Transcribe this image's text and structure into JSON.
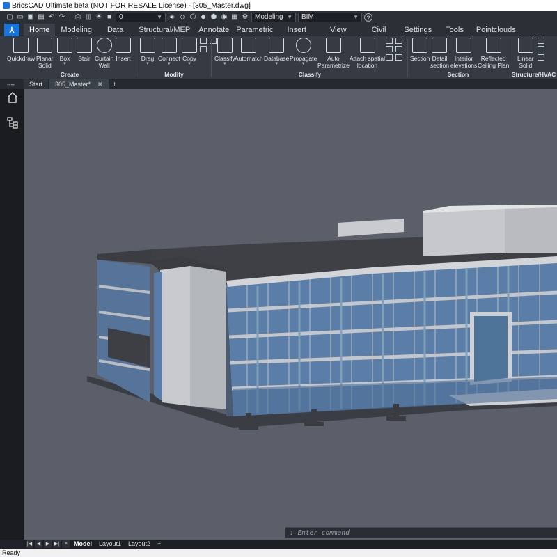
{
  "window": {
    "title": "BricsCAD Ultimate beta (NOT FOR RESALE License) - [305_Master.dwg]"
  },
  "quick_access": {
    "layer_value": "0",
    "workspace_value": "Modeling",
    "profile_value": "BIM",
    "help_label": "?"
  },
  "ribbon_tabs": [
    "Home",
    "Modeling",
    "Data",
    "Structural/MEP",
    "Annotate",
    "Parametric",
    "Insert",
    "View",
    "Civil",
    "Settings",
    "Tools",
    "Pointclouds"
  ],
  "ribbon": {
    "create": {
      "label": "Create",
      "quickdraw": "Quickdraw",
      "planar_solid": "Planar\nSolid",
      "box": "Box",
      "stair": "Stair",
      "curtain_wall": "Curtain\nWall",
      "insert": "Insert"
    },
    "modify": {
      "label": "Modify",
      "drag": "Drag",
      "connect": "Connect",
      "copy": "Copy"
    },
    "classify": {
      "label": "Classify",
      "classify": "Classify",
      "automatch": "Automatch",
      "database": "Database",
      "propagate": "Propagate",
      "auto_parametrize": "Auto\nParametrize",
      "attach_spatial": "Attach spatial\nlocation"
    },
    "section": {
      "label": "Section",
      "section": "Section",
      "detail_section": "Detail\nsection",
      "interior_elevations": "Interior\nelevations",
      "reflected_ceiling": "Reflected\nCeiling Plan"
    },
    "structure": {
      "label": "Structure/HVAC",
      "linear_solid": "Linear\nSolid"
    }
  },
  "doc_tabs": {
    "start": "Start",
    "active": "305_Master*"
  },
  "command": {
    "placeholder": ": Enter command"
  },
  "layout_tabs": [
    "Model",
    "Layout1",
    "Layout2"
  ],
  "status": {
    "text": "Ready"
  },
  "colors": {
    "accent": "#1a73d9",
    "viewport_bg": "#5a5f69",
    "ribbon_bg": "#363b43"
  }
}
